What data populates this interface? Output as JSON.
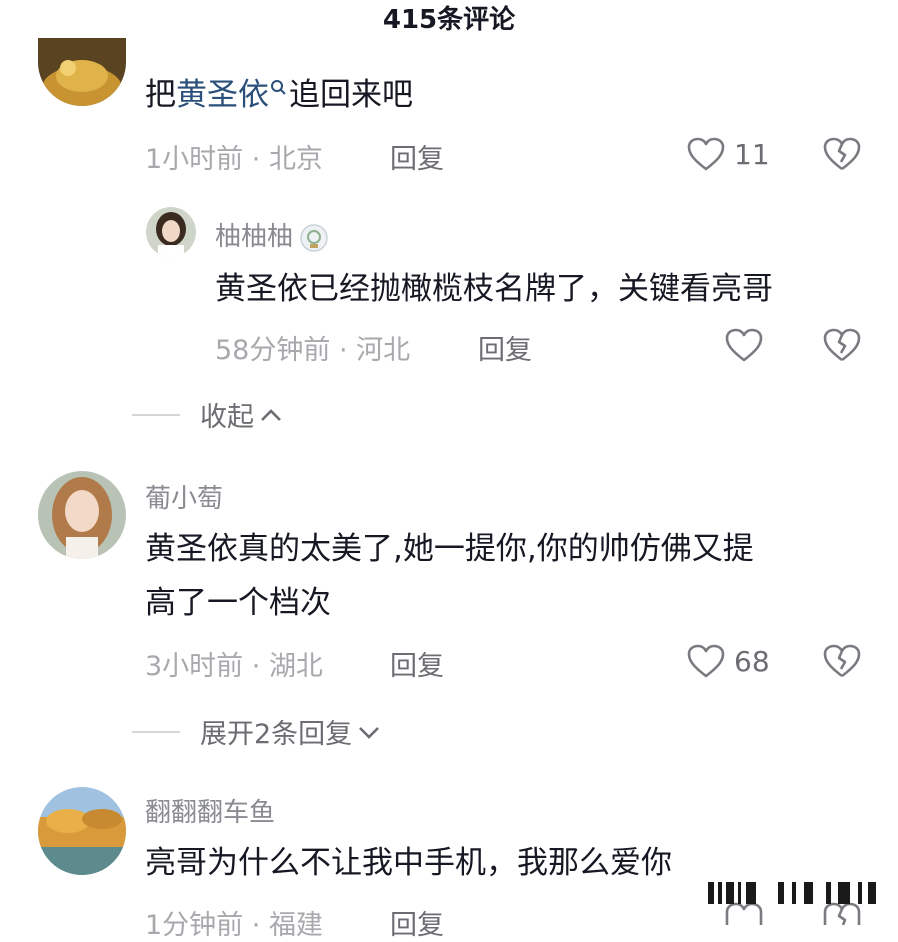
{
  "header": {
    "title": "415条评论"
  },
  "comments": [
    {
      "text_plain": "把",
      "text_link": "黄圣依",
      "text_after": "追回来吧",
      "time": "1小时前",
      "sep": " · ",
      "location": "北京",
      "reply_label": "回复",
      "likes": "11",
      "sub": {
        "username": "柚柚柚",
        "text": "黄圣依已经抛橄榄枝名牌了，关键看亮哥",
        "time": "58分钟前",
        "sep": " · ",
        "location": "河北",
        "reply_label": "回复"
      },
      "collapse_label": "收起"
    },
    {
      "username": "葡小萄",
      "line1": "黄圣依真的太美了,她一提你,你的帅仿佛又提",
      "line2": "高了一个档次",
      "time": "3小时前",
      "sep": " · ",
      "location": "湖北",
      "reply_label": "回复",
      "likes": "68",
      "expand_label": "展开2条回复"
    },
    {
      "username": "翻翻翻车鱼",
      "text": "亮哥为什么不让我中手机，我那么爱你",
      "time": "1分钟前",
      "sep": " · ",
      "location": "福建",
      "reply_label": "回复"
    }
  ],
  "colors": {
    "link": "#2a4f7a",
    "meta": "#a8a9ad",
    "text": "#161823"
  }
}
